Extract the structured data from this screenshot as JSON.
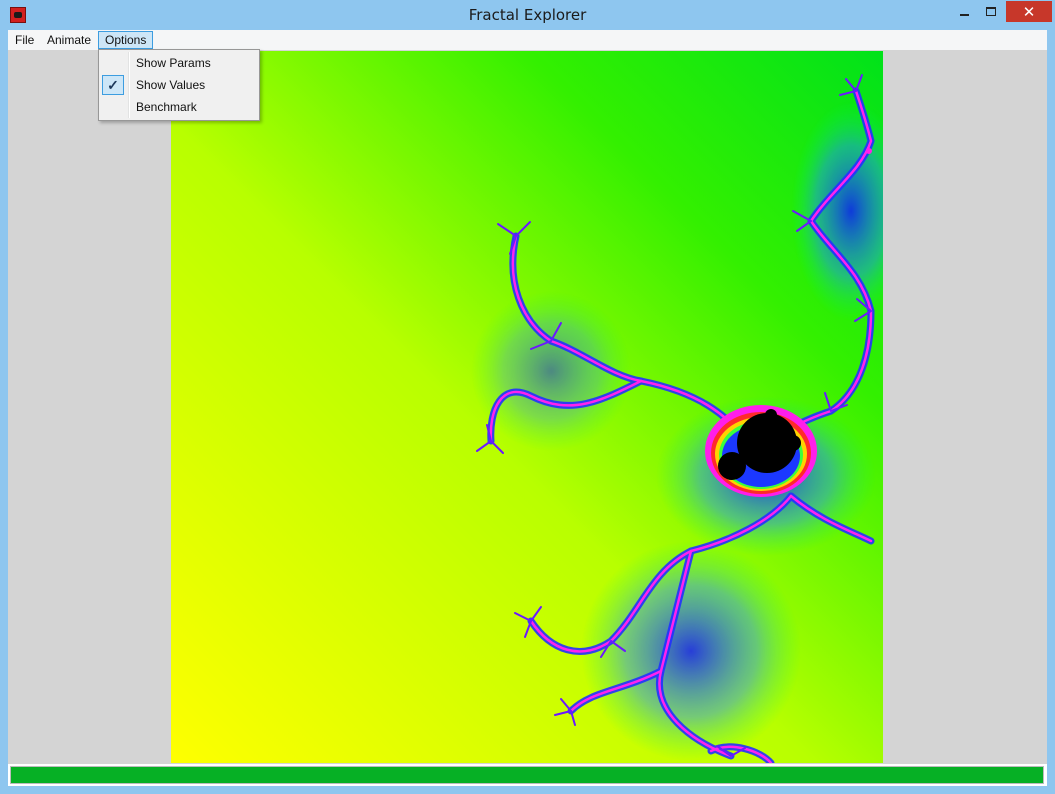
{
  "window": {
    "title": "Fractal Explorer",
    "buttons": {
      "minimize": "minimize",
      "maximize": "maximize",
      "close": "✕"
    }
  },
  "menubar": {
    "items": [
      {
        "label": "File"
      },
      {
        "label": "Animate"
      },
      {
        "label": "Options"
      }
    ]
  },
  "options_menu": {
    "items": [
      {
        "label": "Show Params",
        "checked": false
      },
      {
        "label": "Show Values",
        "checked": true,
        "check_glyph": "✓"
      },
      {
        "label": "Benchmark",
        "checked": false
      }
    ]
  },
  "progress": {
    "fraction": 1.0,
    "color": "#06b025"
  },
  "colors": {
    "fractal_background_left": "#f4ff00",
    "fractal_background_right": "#00e61a",
    "fractal_edge_blue": "#1a2cff",
    "fractal_edge_magenta": "#ff1eea",
    "fractal_core": "#000000",
    "close_button": "#c7372a",
    "titlebar": "#8ec6ef"
  }
}
